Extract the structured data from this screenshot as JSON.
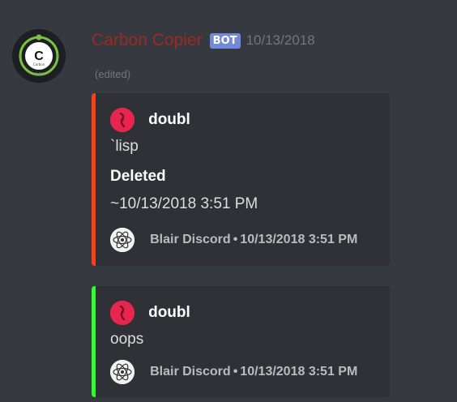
{
  "message": {
    "author": "Carbon Copier",
    "bot_badge": "BOT",
    "timestamp": "10/13/2018",
    "edited": "(edited)",
    "avatar_icon": "carbon-element-avatar-icon",
    "avatar_letter": "C",
    "avatar_caption": "Carbon",
    "avatar_number": "12.011"
  },
  "embeds": [
    {
      "color": "#ff3f16",
      "author": {
        "name": "doubl",
        "icon": "user-avatar-icon"
      },
      "description": "`lisp",
      "field": {
        "name": "Deleted",
        "value": "~10/13/2018 3:51 PM"
      },
      "footer": {
        "icon": "atom-logo-icon",
        "text": "Blair Discord",
        "separator": "•",
        "timestamp": "10/13/2018 3:51 PM"
      }
    },
    {
      "color": "#2dff2d",
      "author": {
        "name": "doubl",
        "icon": "user-avatar-icon"
      },
      "description": "oops",
      "footer": {
        "icon": "atom-logo-icon",
        "text": "Blair Discord",
        "separator": "•",
        "timestamp": "10/13/2018 3:51 PM"
      }
    }
  ],
  "colors": {
    "background": "#36393f",
    "embed_background": "#2f3136",
    "username": "#9b2a22",
    "bot_badge": "#7289da"
  }
}
